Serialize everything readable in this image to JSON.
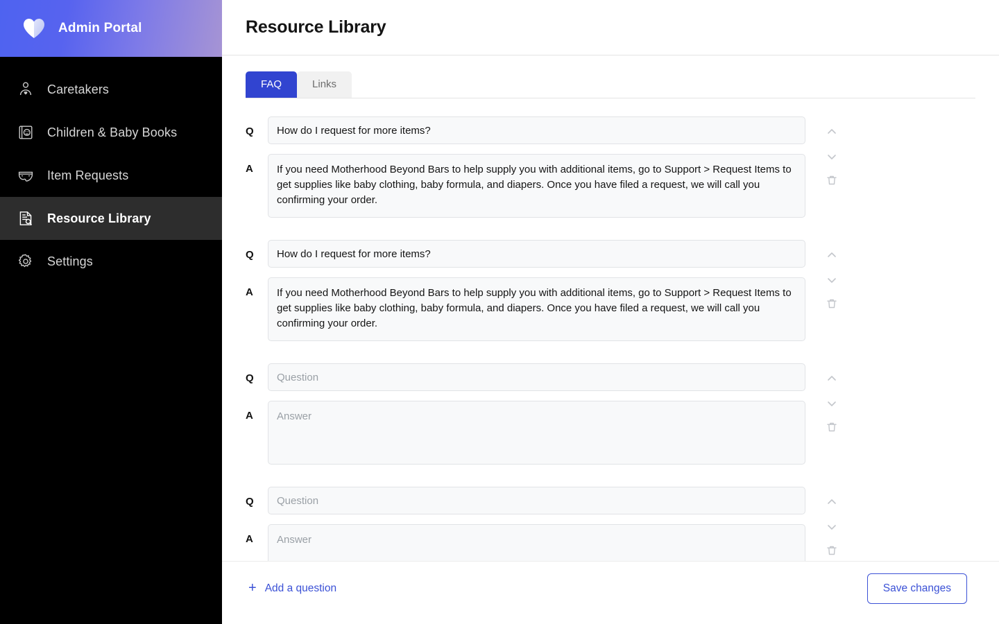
{
  "brand": {
    "title": "Admin Portal",
    "logo_icon": "split-heart-icon",
    "gradient_from": "#4e63f0",
    "gradient_to": "#a694d4"
  },
  "sidebar": {
    "background": "#000000",
    "active_background": "#2d2d2d",
    "items": [
      {
        "label": "Caretakers",
        "icon": "person-heart-icon",
        "active": false
      },
      {
        "label": "Children & Baby Books",
        "icon": "baby-book-icon",
        "active": false
      },
      {
        "label": "Item Requests",
        "icon": "diaper-icon",
        "active": false
      },
      {
        "label": "Resource Library",
        "icon": "document-search-icon",
        "active": true
      },
      {
        "label": "Settings",
        "icon": "gear-icon",
        "active": false
      }
    ]
  },
  "header": {
    "title": "Resource Library"
  },
  "tabs": {
    "active_color": "#3144d0",
    "items": [
      {
        "label": "FAQ",
        "active": true
      },
      {
        "label": "Links",
        "active": false
      }
    ]
  },
  "faq": {
    "q_label": "Q",
    "a_label": "A",
    "question_placeholder": "Question",
    "answer_placeholder": "Answer",
    "move_up_icon": "chevron-up-icon",
    "move_down_icon": "chevron-down-icon",
    "delete_icon": "trash-icon",
    "items": [
      {
        "question": "How do I request for more items?",
        "answer": "If you need Motherhood Beyond Bars to help supply you with additional items, go to Support > Request Items to get supplies like baby clothing, baby formula, and diapers. Once you have filed a request, we will call you confirming your order."
      },
      {
        "question": "How do I request for more items?",
        "answer": "If you need Motherhood Beyond Bars to help supply you with additional items, go to Support > Request Items to get supplies like baby clothing, baby formula, and diapers. Once you have filed a request, we will call you confirming your order."
      },
      {
        "question": "",
        "answer": ""
      },
      {
        "question": "",
        "answer": ""
      }
    ]
  },
  "footer": {
    "add_label": "Add a question",
    "add_icon": "plus-icon",
    "save_label": "Save changes",
    "accent_color": "#3b51d6"
  }
}
